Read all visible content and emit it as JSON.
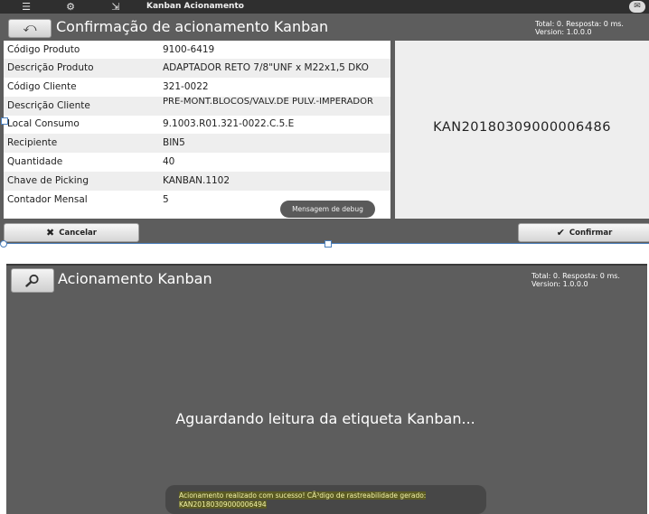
{
  "topbar": {
    "app_title": "Kanban Acionamento",
    "icons": [
      "menu-icon",
      "gear-icon",
      "exit-icon",
      "chat-icon"
    ]
  },
  "confirmation": {
    "title": "Confirmação de acionamento Kanban",
    "status_line1": "Total: 0. Resposta: 0 ms.",
    "status_line2": "Version: 1.0.0.0",
    "rows": [
      {
        "label": "Código Produto",
        "value": "9100-6419"
      },
      {
        "label": "Descrição Produto",
        "value": "ADAPTADOR RETO 7/8\"UNF x M22x1,5 DKO"
      },
      {
        "label": "Código Cliente",
        "value": "321-0022"
      },
      {
        "label": "Descrição Cliente",
        "value": "PRE-MONT.BLOCOS/VALV.DE PULV.-IMPERADOR"
      },
      {
        "label": "Local Consumo",
        "value": "9.1003.R01.321-0022.C.5.E"
      },
      {
        "label": "Recipiente",
        "value": "BIN5"
      },
      {
        "label": "Quantidade",
        "value": "40"
      },
      {
        "label": "Chave de Picking",
        "value": "KANBAN.1102"
      },
      {
        "label": "Contador Mensal",
        "value": "5"
      }
    ],
    "kanban_code": "KAN20180309000006486",
    "debug_label": "Mensagem de debug",
    "cancel_label": "Cancelar",
    "confirm_label": "Confirmar"
  },
  "acionamento": {
    "title": "Acionamento Kanban",
    "status_line1": "Total: 0. Resposta: 0 ms.",
    "status_line2": "Version: 1.0.0.0",
    "waiting_text": "Aguardando leitura da etiqueta Kanban...",
    "toast_line1": "Acionamento realizado com sucesso! CÃ³digo de rastreabilidade gerado:",
    "toast_line2": "KAN20180309000006494"
  }
}
